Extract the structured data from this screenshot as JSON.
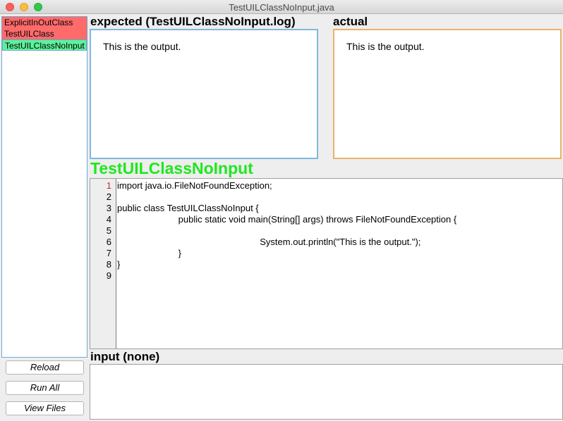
{
  "window": {
    "title": "TestUILClassNoInput.java"
  },
  "test_list": {
    "items": [
      {
        "label": "ExplicitInOutClass",
        "status": "fail"
      },
      {
        "label": "TestUILClass",
        "status": "fail"
      },
      {
        "label": "TestUILClassNoInput",
        "status": "pass"
      }
    ]
  },
  "buttons": {
    "reload": "Reload",
    "run_all": "Run All",
    "view_files": "View Files"
  },
  "expected": {
    "heading": "expected (TestUILClassNoInput.log)",
    "text": "This is the output."
  },
  "actual": {
    "heading": "actual",
    "text": "This is the output."
  },
  "class_title": "TestUILClassNoInput",
  "source": {
    "lines": [
      "import java.io.FileNotFoundException;",
      "",
      "public class TestUILClassNoInput {",
      "\t\t\tpublic static void main(String[] args) throws FileNotFoundException {",
      "",
      "\t\t\t\t\t\t\tSystem.out.println(\"This is the output.\");",
      "\t\t\t}",
      "}",
      ""
    ]
  },
  "input": {
    "heading": "input (none)"
  },
  "colors": {
    "fail": "#ff6b6b",
    "pass": "#5ef29a",
    "class_title": "#1ee81e",
    "expected_border": "#7fb9dd",
    "actual_border": "#e8b36a"
  }
}
